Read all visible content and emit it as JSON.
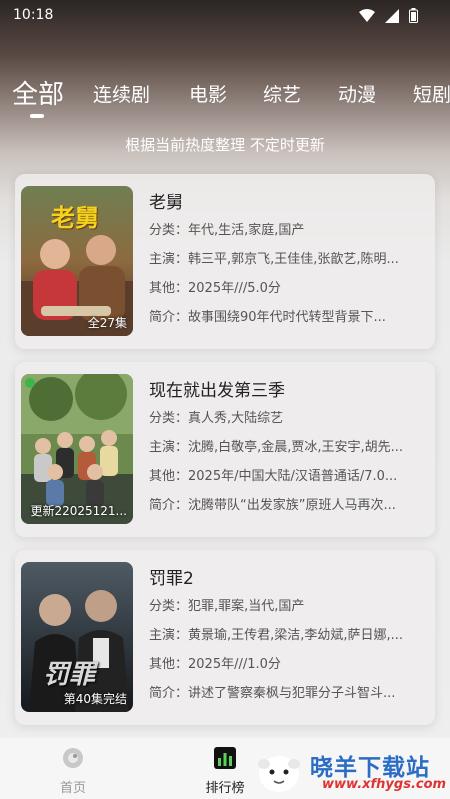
{
  "status": {
    "time": "10:18"
  },
  "tabs": [
    {
      "label": "全部"
    },
    {
      "label": "连续剧"
    },
    {
      "label": "电影"
    },
    {
      "label": "综艺"
    },
    {
      "label": "动漫"
    },
    {
      "label": "短剧"
    }
  ],
  "subtitle": "根据当前热度整理 不定时更新",
  "items": [
    {
      "title": "老舅",
      "badge": "全27集",
      "category": "分类：年代,生活,家庭,国产",
      "cast": "主演：韩三平,郭京飞,王佳佳,张歆艺,陈明...",
      "other": "其他：2025年///5.0分",
      "intro": "简介：故事围绕90年代时代转型背景下...",
      "poster_text": "老舅"
    },
    {
      "title": "现在就出发第三季",
      "badge": "更新22025121...",
      "category": "分类：真人秀,大陆综艺",
      "cast": "主演：沈腾,白敬亭,金晨,贾冰,王安宇,胡先...",
      "other": "其他：2025年/中国大陆/汉语普通话/7.0...",
      "intro": "简介：沈腾带队“出发家族”原班人马再次...",
      "poster_text": ""
    },
    {
      "title": "罚罪2",
      "badge": "第40集完结",
      "category": "分类：犯罪,罪案,当代,国产",
      "cast": "主演：黄景瑜,王传君,梁洁,李幼斌,萨日娜,...",
      "other": "其他：2025年///1.0分",
      "intro": "简介：讲述了警察秦枫与犯罪分子斗智斗...",
      "poster_text": "罚罪"
    }
  ],
  "tabbar": [
    {
      "label": "首页"
    },
    {
      "label": "排行榜"
    }
  ],
  "watermark": {
    "cn": "晓羊下载站",
    "en": "www.xfhygs.com"
  }
}
